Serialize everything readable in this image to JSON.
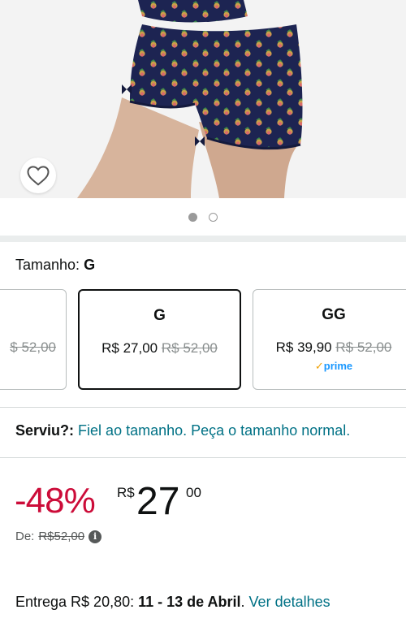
{
  "image": {
    "carousel_total": 2,
    "carousel_active": 1
  },
  "size_selector": {
    "label": "Tamanho:",
    "selected_value": "G",
    "options": [
      {
        "name": "",
        "price": "",
        "list_price": "$ 52,00",
        "prime": false
      },
      {
        "name": "G",
        "price": "R$ 27,00",
        "list_price": "R$ 52,00",
        "prime": false,
        "selected": true
      },
      {
        "name": "GG",
        "price": "R$ 39,90",
        "list_price": "R$ 52,00",
        "prime": true,
        "prime_label": "prime"
      }
    ]
  },
  "fit": {
    "label": "Serviu?:",
    "value": "Fiel ao tamanho. Peça o tamanho normal."
  },
  "price": {
    "discount": "-48%",
    "currency": "R$",
    "whole": "27",
    "fraction": "00",
    "list_label": "De:",
    "list_value": "R$52,00"
  },
  "delivery": {
    "prefix": "Entrega R$ 20,80:",
    "dates": "11 - 13 de Abril",
    "separator": ".",
    "details_link": "Ver detalhes"
  },
  "colors": {
    "discount": "#cc0c39",
    "link": "#007185",
    "prime": "#1a98ff"
  },
  "icons": {
    "wishlist": "heart-outline-icon",
    "info": "info-icon",
    "prime_check": "checkmark-icon"
  }
}
